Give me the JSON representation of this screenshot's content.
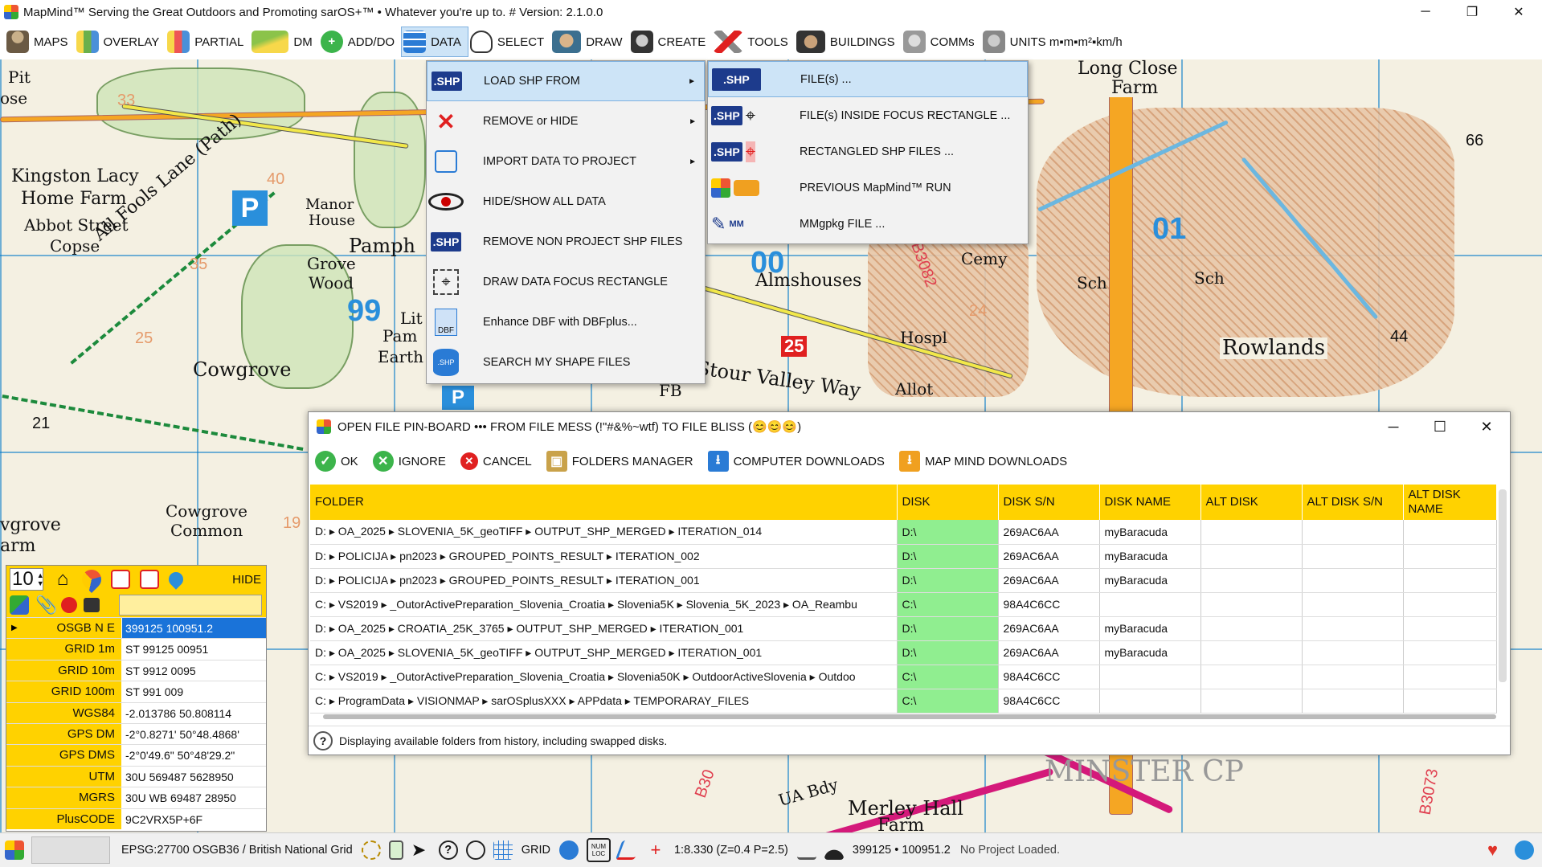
{
  "window": {
    "title": "MapMind™ Serving the Great Outdoors and Promoting sarOS+™ • Whatever you're up to. #  Version: 2.1.0.0",
    "minimize": "─",
    "maximize": "❐",
    "close": "✕"
  },
  "toolbar": {
    "items": [
      {
        "label": "MAPS",
        "icon": "person-icon"
      },
      {
        "label": "OVERLAY",
        "icon": "map-icon"
      },
      {
        "label": "PARTIAL",
        "icon": "map-partial-icon"
      },
      {
        "label": "DM",
        "icon": "terrain-icon"
      },
      {
        "label": "ADD/DO",
        "icon": "plus-icon"
      },
      {
        "label": "DATA",
        "icon": "database-icon"
      },
      {
        "label": "SELECT",
        "icon": "pointer-icon"
      },
      {
        "label": "DRAW",
        "icon": "artist-icon"
      },
      {
        "label": "CREATE",
        "icon": "inventor-icon"
      },
      {
        "label": "TOOLS",
        "icon": "tools-icon"
      },
      {
        "label": "BUILDINGS",
        "icon": "builder-icon"
      },
      {
        "label": "COMMs",
        "icon": "comms-icon"
      },
      {
        "label": "UNITS m▪m▪m²▪km/h",
        "icon": "units-icon"
      }
    ]
  },
  "data_menu": {
    "items": [
      {
        "label": "LOAD SHP FROM",
        "has_submenu": true
      },
      {
        "label": "REMOVE or HIDE",
        "has_submenu": true
      },
      {
        "label": "IMPORT  DATA TO PROJECT",
        "has_submenu": true
      },
      {
        "label": "HIDE/SHOW ALL DATA",
        "has_submenu": false
      },
      {
        "label": "REMOVE NON PROJECT SHP FILES",
        "has_submenu": false
      },
      {
        "label": "DRAW DATA FOCUS RECTANGLE",
        "has_submenu": false
      },
      {
        "label": "Enhance DBF with DBFplus...",
        "has_submenu": false
      },
      {
        "label": "SEARCH MY SHAPE FILES",
        "has_submenu": false
      }
    ],
    "shp_text": ".SHP",
    "dbf_text": "DBF",
    "arrow": "►"
  },
  "sub_menu": {
    "items": [
      {
        "label": "FILE(s) ..."
      },
      {
        "label": "FILE(s)  INSIDE FOCUS RECTANGLE ..."
      },
      {
        "label": "RECTANGLED SHP FILES ..."
      },
      {
        "label": "PREVIOUS MapMind™ RUN"
      },
      {
        "label": "MMgpkg FILE ..."
      }
    ],
    "shp_text": ".SHP",
    "mm_text": "MM"
  },
  "pinboard": {
    "title": "OPEN FILE PIN-BOARD ••• FROM FILE MESS (!\"#&%~wtf) TO FILE BLISS  (😊😊😊)",
    "actions": [
      {
        "label": "OK",
        "color": "#3cb44b",
        "glyph": "✓"
      },
      {
        "label": "IGNORE",
        "color": "#3cb44b",
        "glyph": "✕"
      },
      {
        "label": "CANCEL",
        "color": "#e02020",
        "glyph": "✕"
      },
      {
        "label": "FOLDERS MANAGER",
        "color": "#c9a24a",
        "glyph": "▣"
      },
      {
        "label": "COMPUTER DOWNLOADS",
        "color": "#2a7bd5",
        "glyph": "⭳"
      },
      {
        "label": "MAP MIND DOWNLOADS",
        "color": "#f0a020",
        "glyph": "⭳"
      }
    ],
    "columns": [
      "FOLDER",
      "DISK",
      "DISK S/N",
      "DISK NAME",
      "ALT DISK",
      "ALT DISK S/N",
      "ALT DISK NAME"
    ],
    "rows": [
      [
        "D:  ▸  OA_2025  ▸  SLOVENIA_5K_geoTIFF  ▸  OUTPUT_SHP_MERGED  ▸  ITERATION_014",
        "D:\\",
        "269AC6AA",
        "myBaracuda",
        "",
        "",
        ""
      ],
      [
        "D:  ▸  POLICIJA  ▸  pn2023  ▸  GROUPED_POINTS_RESULT  ▸  ITERATION_002",
        "D:\\",
        "269AC6AA",
        "myBaracuda",
        "",
        "",
        ""
      ],
      [
        "D:  ▸  POLICIJA  ▸  pn2023  ▸  GROUPED_POINTS_RESULT  ▸  ITERATION_001",
        "D:\\",
        "269AC6AA",
        "myBaracuda",
        "",
        "",
        ""
      ],
      [
        "C:  ▸  VS2019  ▸  _OutorActivePreparation_Slovenia_Croatia  ▸  Slovenia5K  ▸  Slovenia_5K_2023  ▸  OA_Reambu",
        "C:\\",
        "98A4C6CC",
        "",
        "",
        "",
        ""
      ],
      [
        "D:  ▸  OA_2025  ▸  CROATIA_25K_3765  ▸  OUTPUT_SHP_MERGED  ▸  ITERATION_001",
        "D:\\",
        "269AC6AA",
        "myBaracuda",
        "",
        "",
        ""
      ],
      [
        "D:  ▸  OA_2025  ▸  SLOVENIA_5K_geoTIFF  ▸  OUTPUT_SHP_MERGED  ▸  ITERATION_001",
        "D:\\",
        "269AC6AA",
        "myBaracuda",
        "",
        "",
        ""
      ],
      [
        "C:  ▸  VS2019  ▸  _OutorActivePreparation_Slovenia_Croatia  ▸  Slovenia50K  ▸  OutdoorActiveSlovenia  ▸  Outdoo",
        "C:\\",
        "98A4C6CC",
        "",
        "",
        "",
        ""
      ],
      [
        "C:  ▸  ProgramData  ▸  VISIONMAP  ▸  sarOSplusXXX  ▸  APPdata  ▸  TEMPORARAY_FILES",
        "C:\\",
        "98A4C6CC",
        "",
        "",
        "",
        ""
      ]
    ],
    "status": "Displaying available folders from history, including swapped disks.",
    "help": "?",
    "minimize": "─",
    "maximize": "☐",
    "close": "✕"
  },
  "coord_panel": {
    "zoom": "10",
    "hide_label": "HIDE",
    "rows": [
      {
        "key": "OSGB N E",
        "value": "399125 100951.2",
        "selected": true
      },
      {
        "key": "GRID 1m",
        "value": "ST 99125 00951"
      },
      {
        "key": "GRID 10m",
        "value": "ST 9912 0095"
      },
      {
        "key": "GRID 100m",
        "value": "ST 991 009"
      },
      {
        "key": "WGS84",
        "value": "-2.013786 50.808114"
      },
      {
        "key": "GPS DM",
        "value": "-2°0.8271' 50°48.4868'"
      },
      {
        "key": "GPS DMS",
        "value": "-2°0'49.6\" 50°48'29.2\""
      },
      {
        "key": "UTM",
        "value": "30U 569487 5628950"
      },
      {
        "key": "MGRS",
        "value": "30U WB 69487 28950"
      },
      {
        "key": "PlusCODE",
        "value": "9C2VRX5P+6F"
      }
    ],
    "row_marker": "▶"
  },
  "statusbar": {
    "crs": "EPSG:27700 OSGB36 / British National Grid",
    "grid_label": "GRID",
    "numloc": "NUM LOC",
    "scale": "1:8.330 (Z=0.4 P=2.5)",
    "coords": "399125 • 100951.2",
    "project": "No Project Loaded."
  },
  "map": {
    "labels": [
      "Pit",
      "ose",
      "Kingston Lacy",
      "Home Farm",
      "Abbot Street",
      "Copse",
      "All Fools Lane (Path)",
      "Manor",
      "House",
      "Pamph",
      "Grove",
      "Wood",
      "Lit",
      "Pam",
      "Earth",
      "Cowgrove",
      "Cowgrove",
      "Common",
      "vgrove",
      "arm",
      "Long Close",
      "Farm",
      "Cemy",
      "Sch",
      "Sch",
      "Almshouses",
      "Hospl",
      "Rowlands",
      "Stour Valley Way",
      "FB",
      "Allot",
      "Merley Hall",
      "Farm",
      "UA Bdy",
      "MINSTER CP"
    ],
    "numbers": [
      "33",
      "40",
      "35",
      "25",
      "21",
      "19",
      "99",
      "00",
      "01",
      "66",
      "44",
      "24",
      "25",
      "B3082",
      "B30",
      "B3073"
    ],
    "parking": "P"
  }
}
